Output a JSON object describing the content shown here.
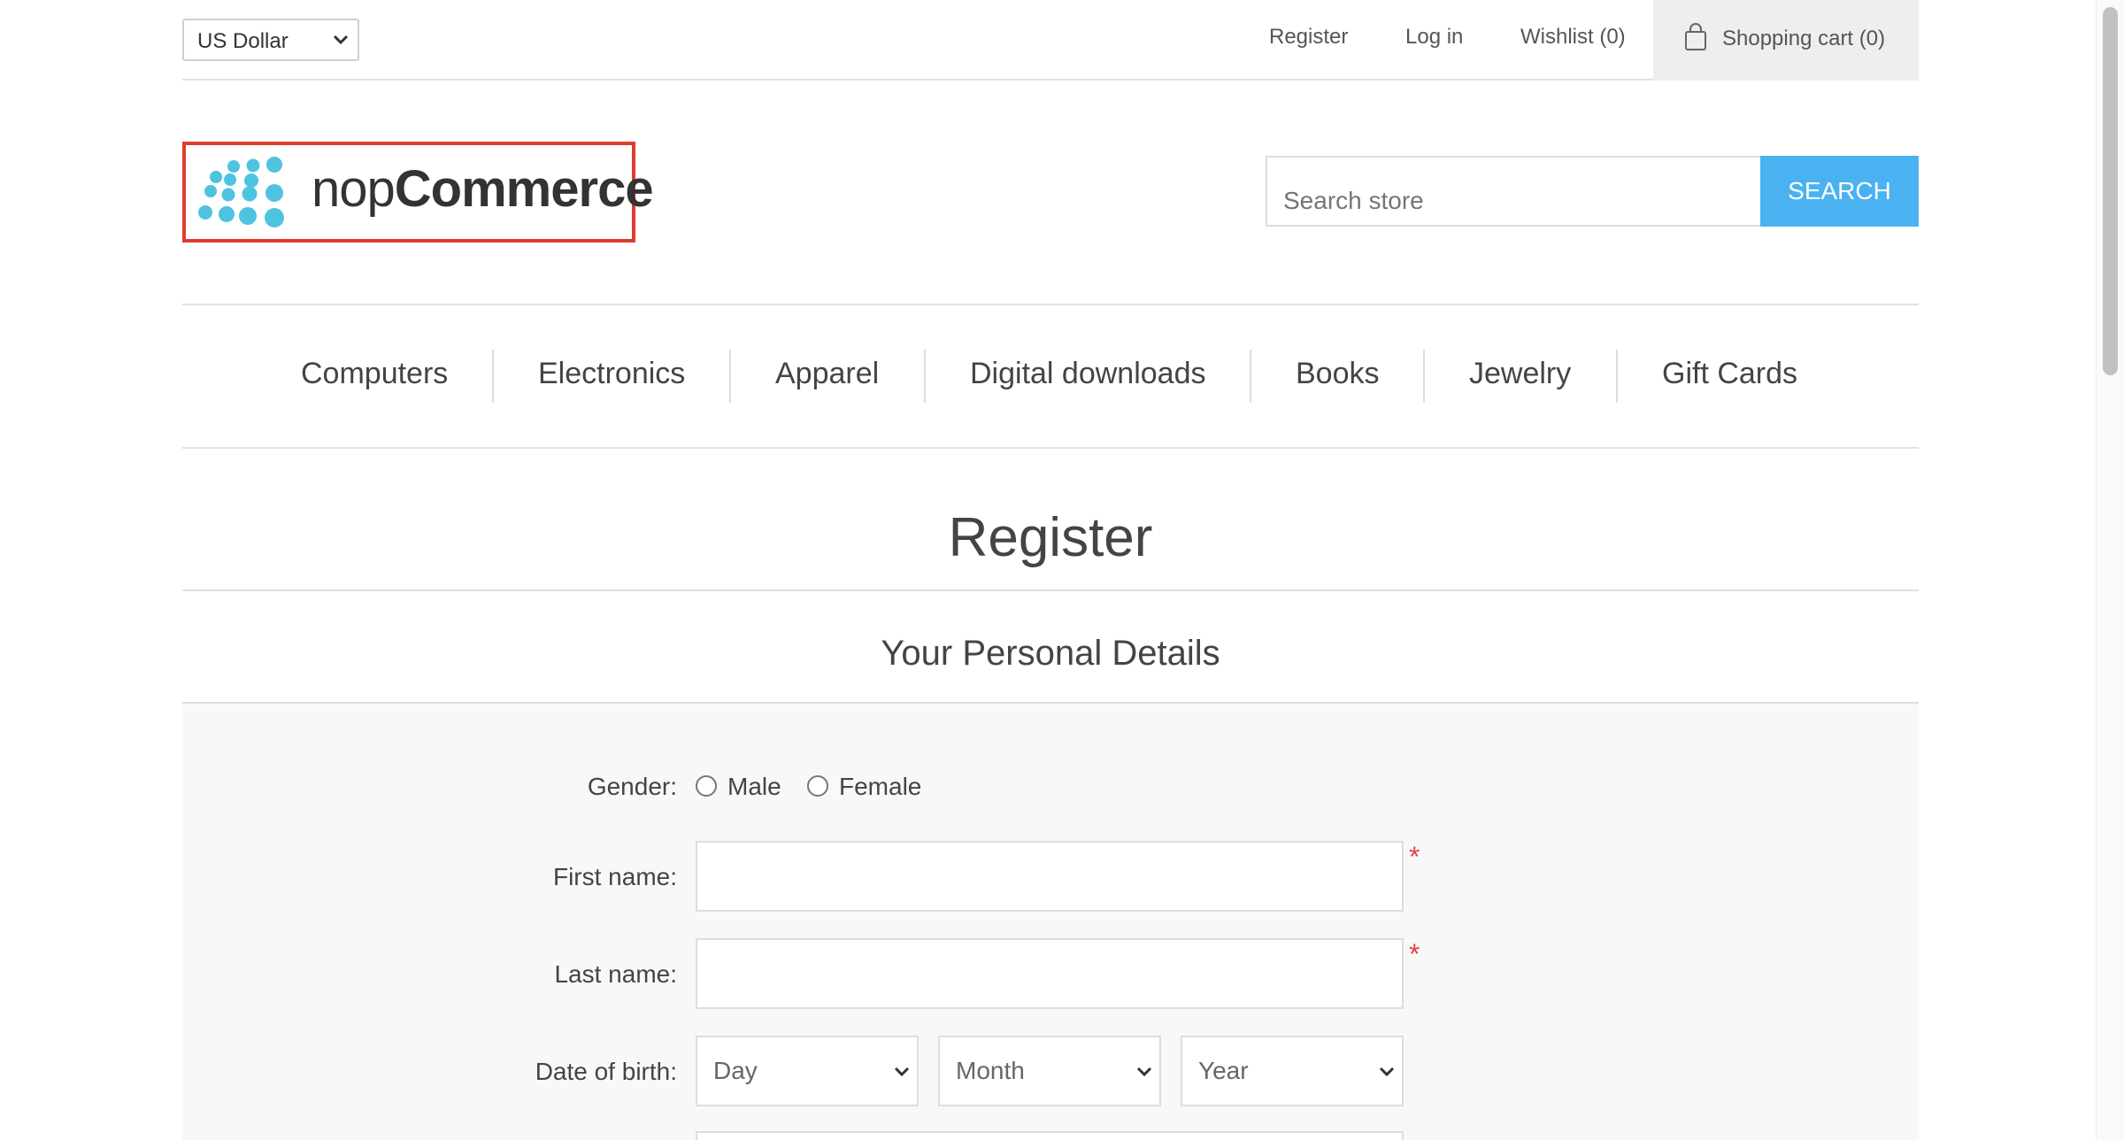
{
  "header": {
    "currency": "US Dollar",
    "links": {
      "register": "Register",
      "login": "Log in",
      "wishlist": "Wishlist (0)",
      "cart": "Shopping cart (0)"
    }
  },
  "logo": {
    "prefix": "nop",
    "suffix": "Commerce",
    "accent_color": "#4ec3e0"
  },
  "search": {
    "placeholder": "Search store",
    "button": "SEARCH",
    "button_color": "#4ab2f1"
  },
  "nav": {
    "items": [
      "Computers",
      "Electronics",
      "Apparel",
      "Digital downloads",
      "Books",
      "Jewelry",
      "Gift Cards"
    ]
  },
  "page": {
    "title": "Register",
    "section": "Your Personal Details"
  },
  "form": {
    "gender_label": "Gender:",
    "gender_options": [
      "Male",
      "Female"
    ],
    "first_name_label": "First name:",
    "last_name_label": "Last name:",
    "dob_label": "Date of birth:",
    "dob_day": "Day",
    "dob_month": "Month",
    "dob_year": "Year",
    "required_marker": "*"
  }
}
